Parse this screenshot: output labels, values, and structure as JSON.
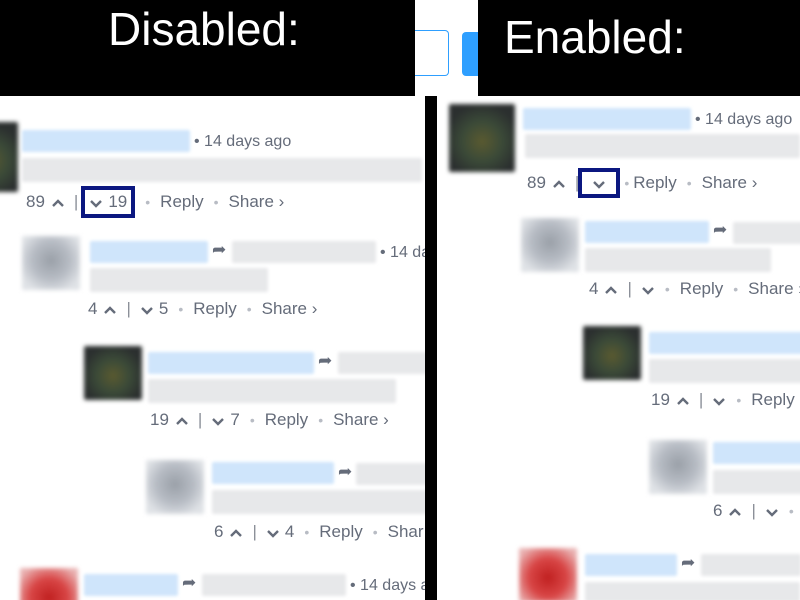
{
  "banners": {
    "left": "Disabled:",
    "right": "Enabled:"
  },
  "labels": {
    "reply": "Reply",
    "share": "Share ›",
    "share_cut": "Shar",
    "age": "14 days ago",
    "age_cut": "14 days",
    "age_cut2": "14 days ag"
  },
  "left": {
    "c1": {
      "up": "89",
      "down": "19"
    },
    "c2": {
      "up": "4",
      "down": "5"
    },
    "c3": {
      "up": "19",
      "down": "7"
    },
    "c4": {
      "up": "6",
      "down": "4"
    }
  },
  "right": {
    "c1": {
      "up": "89"
    },
    "c2": {
      "up": "4"
    },
    "c3": {
      "up": "19"
    },
    "c4": {
      "up": "6"
    }
  },
  "colors": {
    "highlight": "#0b1780",
    "meta": "#656c7a",
    "name_blur": "#cfe5fb"
  }
}
